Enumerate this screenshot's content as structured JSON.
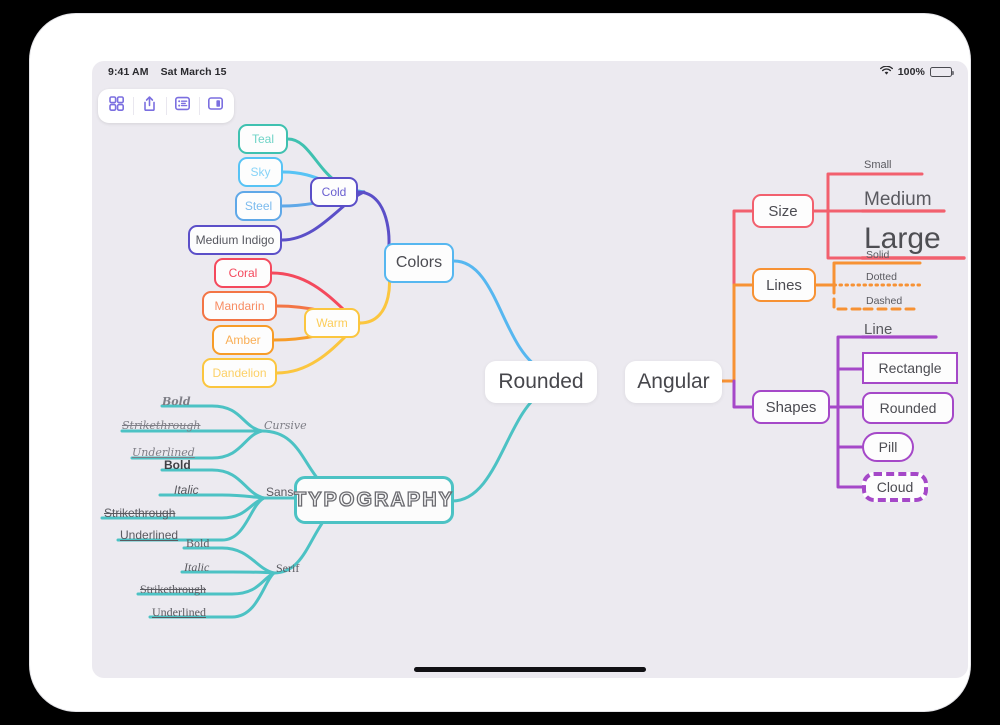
{
  "status_bar": {
    "time": "9:41 AM",
    "date": "Sat March 15",
    "wifi_icon": "wifi-icon",
    "battery_percent": "100%",
    "battery_icon": "battery-full-icon"
  },
  "toolbar": {
    "buttons": [
      {
        "name": "grid-view-button",
        "icon": "grid-icon",
        "label": ""
      },
      {
        "name": "share-button",
        "icon": "share-icon",
        "label": ""
      },
      {
        "name": "outline-view-button",
        "icon": "list-icon",
        "label": ""
      },
      {
        "name": "sidebar-toggle-button",
        "icon": "sidebar-icon",
        "label": ""
      }
    ]
  },
  "mindmap": {
    "hubs": {
      "rounded": "Rounded",
      "angular": "Angular"
    },
    "colors": {
      "root": "Colors",
      "root_color": "#56b7f0",
      "cold": {
        "label": "Cold",
        "color": "#5b4fc8",
        "children": [
          {
            "label": "Teal",
            "color": "#3fc1b0"
          },
          {
            "label": "Sky",
            "color": "#57c3f5"
          },
          {
            "label": "Steel",
            "color": "#5fa8e8"
          },
          {
            "label": "Medium Indigo",
            "color": "#5b4fc8"
          }
        ]
      },
      "warm": {
        "label": "Warm",
        "color": "#fbc63f",
        "children": [
          {
            "label": "Coral",
            "color": "#f4495d"
          },
          {
            "label": "Mandarin",
            "color": "#f37545"
          },
          {
            "label": "Amber",
            "color": "#f79c28"
          },
          {
            "label": "Dandelion",
            "color": "#fbc63f"
          }
        ]
      }
    },
    "typography": {
      "root": "TYPOGRAPHY",
      "root_color": "#4cc2c4",
      "groups": [
        {
          "label": "Cursive",
          "style": "cursive",
          "children": [
            {
              "label": "Bold",
              "style": "cursive bold"
            },
            {
              "label": "Strikethrough",
              "style": "cursive strike"
            },
            {
              "label": "Underlined",
              "style": "cursive under"
            }
          ]
        },
        {
          "label": "Sans Serif",
          "style": "sans",
          "children": [
            {
              "label": "Bold",
              "style": "bold"
            },
            {
              "label": "Italic",
              "style": "italic"
            },
            {
              "label": "Strikethrough",
              "style": "strike"
            },
            {
              "label": "Underlined",
              "style": "under"
            }
          ]
        },
        {
          "label": "Serif",
          "style": "serif",
          "children": [
            {
              "label": "Bold",
              "style": "serif"
            },
            {
              "label": "Italic",
              "style": "serif italic"
            },
            {
              "label": "Strikethrough",
              "style": "serif strike"
            },
            {
              "label": "Underlined",
              "style": "serif under"
            }
          ]
        }
      ]
    },
    "size": {
      "label": "Size",
      "color": "#f2606e",
      "children": [
        {
          "label": "Small",
          "size": "small"
        },
        {
          "label": "Medium",
          "size": "medium"
        },
        {
          "label": "Large",
          "size": "large"
        }
      ]
    },
    "lines": {
      "label": "Lines",
      "color": "#f79234",
      "children": [
        {
          "label": "Solid",
          "stroke": "solid"
        },
        {
          "label": "Dotted",
          "stroke": "dotted"
        },
        {
          "label": "Dashed",
          "stroke": "dashed"
        }
      ]
    },
    "shapes": {
      "label": "Shapes",
      "color": "#a548c8",
      "children": [
        {
          "label": "Line",
          "shape": "line"
        },
        {
          "label": "Rectangle",
          "shape": "rectangle"
        },
        {
          "label": "Rounded",
          "shape": "rounded"
        },
        {
          "label": "Pill",
          "shape": "pill"
        },
        {
          "label": "Cloud",
          "shape": "cloud"
        }
      ]
    }
  }
}
